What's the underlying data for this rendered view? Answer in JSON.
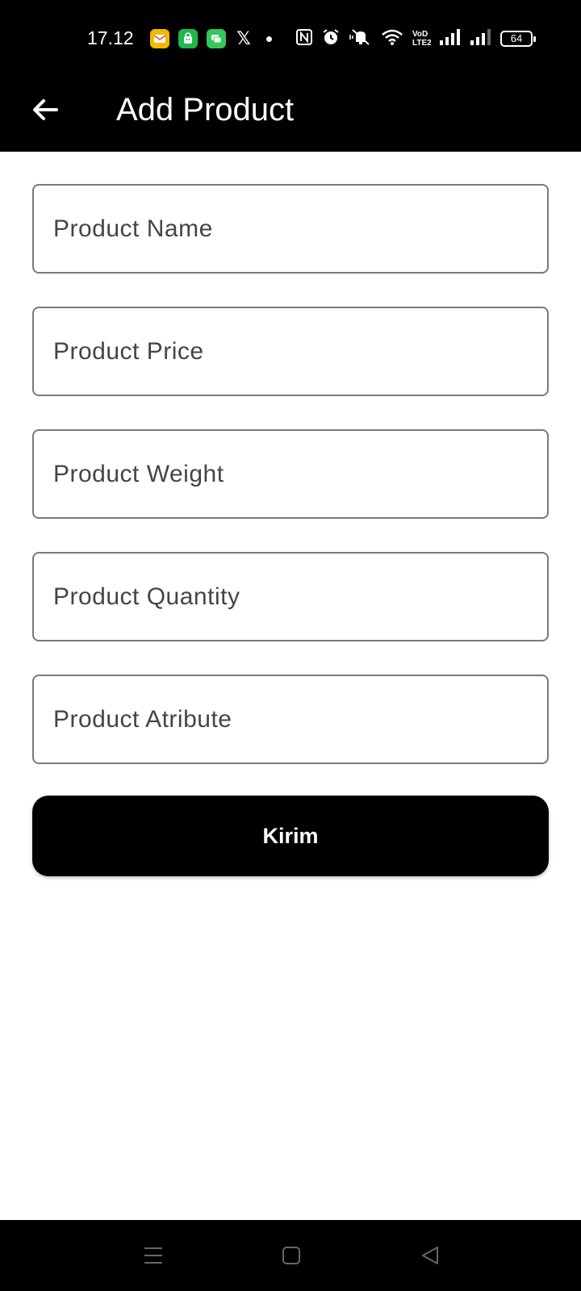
{
  "status_bar": {
    "time": "17.12",
    "battery": "64",
    "icons": [
      "mail-app-icon",
      "tokopedia-icon",
      "chat-app-icon",
      "x-icon",
      "notification-dot-icon",
      "nfc-icon",
      "alarm-icon",
      "muted-icon",
      "wifi-icon",
      "volte-icon",
      "signal-icon",
      "signal-icon-2",
      "battery-icon"
    ]
  },
  "app_bar": {
    "title": "Add Product",
    "back_icon": "arrow-left-icon"
  },
  "form": {
    "fields": [
      {
        "placeholder": "Product Name",
        "value": ""
      },
      {
        "placeholder": "Product Price",
        "value": ""
      },
      {
        "placeholder": "Product Weight",
        "value": ""
      },
      {
        "placeholder": "Product Quantity",
        "value": ""
      },
      {
        "placeholder": "Product Atribute",
        "value": ""
      }
    ],
    "submit_label": "Kirim"
  },
  "nav_bar": {
    "icons": [
      "menu-icon",
      "home-icon",
      "back-triangle-icon"
    ]
  },
  "colors": {
    "bar_background": "#000000",
    "page_background": "#ffffff",
    "field_border": "#7a7a7a",
    "placeholder_text": "#44444a",
    "button_background": "#000000",
    "button_text": "#ffffff"
  }
}
